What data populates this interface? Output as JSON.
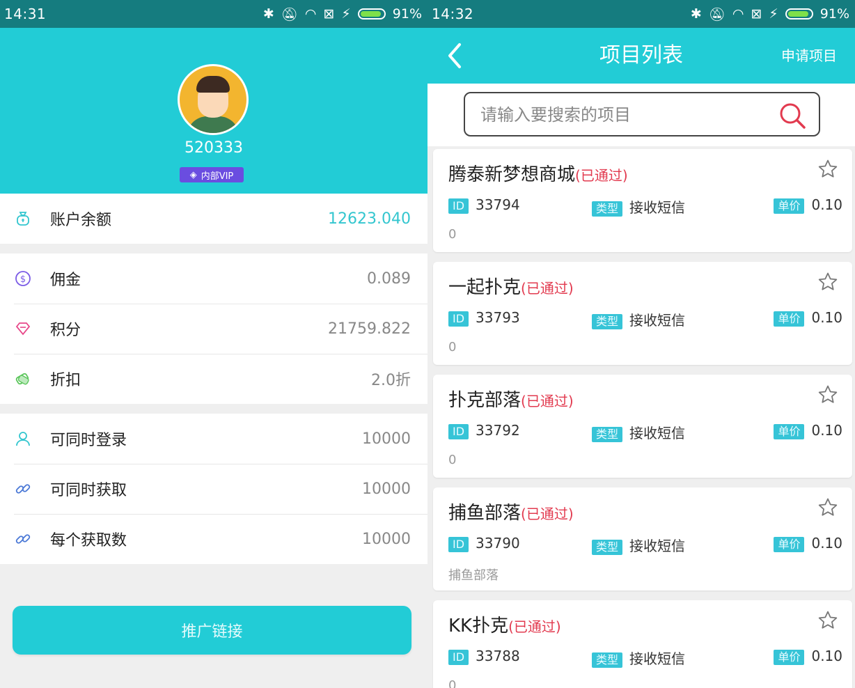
{
  "left": {
    "status": {
      "time": "14:31",
      "battery": "91%"
    },
    "user": {
      "name": "520333",
      "badge": "内部VIP"
    },
    "balance": {
      "label": "账户余额",
      "value": "12623.040"
    },
    "stats": [
      {
        "icon": "dollar-circle-icon",
        "label": "佣金",
        "value": "0.089"
      },
      {
        "icon": "diamond-icon",
        "label": "积分",
        "value": "21759.822"
      },
      {
        "icon": "discount-tag-icon",
        "label": "折扣",
        "value": "2.0折"
      }
    ],
    "limits": [
      {
        "icon": "user-icon",
        "label": "可同时登录",
        "value": "10000"
      },
      {
        "icon": "link-icon",
        "label": "可同时获取",
        "value": "10000"
      },
      {
        "icon": "link-icon",
        "label": "每个获取数",
        "value": "10000"
      }
    ],
    "promo_button": "推广链接"
  },
  "right": {
    "status": {
      "time": "14:32",
      "battery": "91%"
    },
    "header": {
      "title": "项目列表",
      "action": "申请项目"
    },
    "search": {
      "placeholder": "请输入要搜索的项目"
    },
    "tag_labels": {
      "id": "ID",
      "type": "类型",
      "price": "单价"
    },
    "projects": [
      {
        "name": "腾泰新梦想商城",
        "status": "(已通过)",
        "id": "33794",
        "type": "接收短信",
        "price": "0.10",
        "desc": "0"
      },
      {
        "name": "一起扑克",
        "status": "(已通过)",
        "id": "33793",
        "type": "接收短信",
        "price": "0.10",
        "desc": "0"
      },
      {
        "name": "扑克部落",
        "status": "(已通过)",
        "id": "33792",
        "type": "接收短信",
        "price": "0.10",
        "desc": "0"
      },
      {
        "name": "捕鱼部落",
        "status": "(已通过)",
        "id": "33790",
        "type": "接收短信",
        "price": "0.10",
        "desc": "捕鱼部落"
      },
      {
        "name": "KK扑克",
        "status": "(已通过)",
        "id": "33788",
        "type": "接收短信",
        "price": "0.10",
        "desc": "0"
      }
    ]
  },
  "colors": {
    "accent": "#22ccd6",
    "statusbar": "#157c7f",
    "status_text": "#e23a4f",
    "tag": "#36c4d7"
  }
}
